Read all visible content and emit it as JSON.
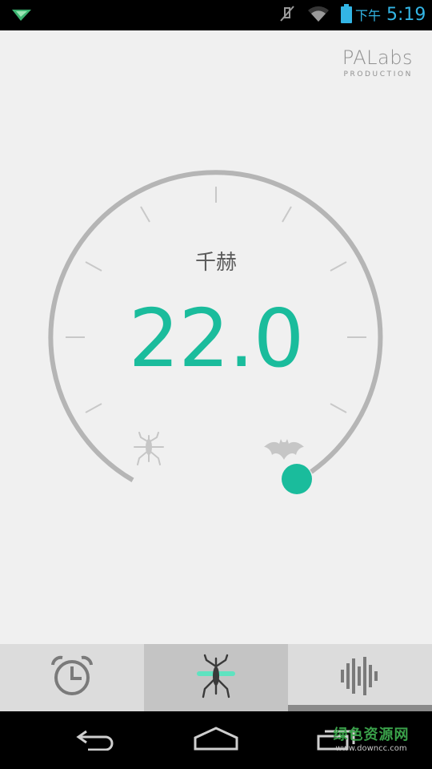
{
  "status_bar": {
    "time_prefix": "下午",
    "time": "5:19",
    "icons": [
      "app-notification-icon",
      "mute-icon",
      "wifi-icon",
      "battery-icon"
    ],
    "accent_color": "#33b5e5"
  },
  "brand": {
    "name": "PALabs",
    "subtitle": "PRODUCTION"
  },
  "dial": {
    "unit_label": "千赫",
    "value": "22.0",
    "value_color": "#1abc9c",
    "arc_color": "#b5b5b5",
    "knob_color": "#1abc9c",
    "low_end_icon": "mosquito-icon",
    "high_end_icon": "bat-icon"
  },
  "tabs": [
    {
      "id": "alarm",
      "icon": "alarm-clock-icon",
      "active": false
    },
    {
      "id": "mosquito",
      "icon": "mosquito-icon",
      "active": true
    },
    {
      "id": "sound",
      "icon": "sound-wave-icon",
      "active": false
    }
  ],
  "nav_bar": {
    "buttons": [
      "back-icon",
      "home-icon",
      "recent-apps-icon"
    ]
  },
  "watermark": {
    "title": "绿色资源网",
    "url": "www.downcc.com"
  }
}
